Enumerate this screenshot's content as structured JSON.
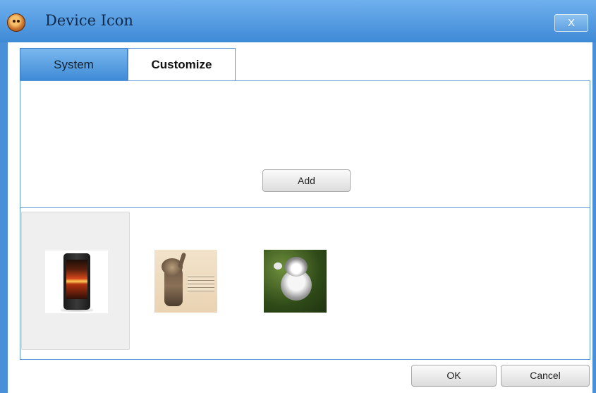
{
  "window": {
    "title": "Device Icon",
    "close_label": "X"
  },
  "tabs": [
    {
      "label": "System",
      "active": false
    },
    {
      "label": "Customize",
      "active": true
    }
  ],
  "upload": {
    "add_label": "Add"
  },
  "icons": [
    {
      "name": "phone",
      "selected": true
    },
    {
      "name": "cat-kitten-standing",
      "selected": false
    },
    {
      "name": "cat-kitten-waving",
      "selected": false
    }
  ],
  "footer": {
    "ok_label": "OK",
    "cancel_label": "Cancel"
  },
  "colors": {
    "titlebar": "#4a90d9",
    "border": "#5d9ad8",
    "selected_tile": "#efefef"
  }
}
